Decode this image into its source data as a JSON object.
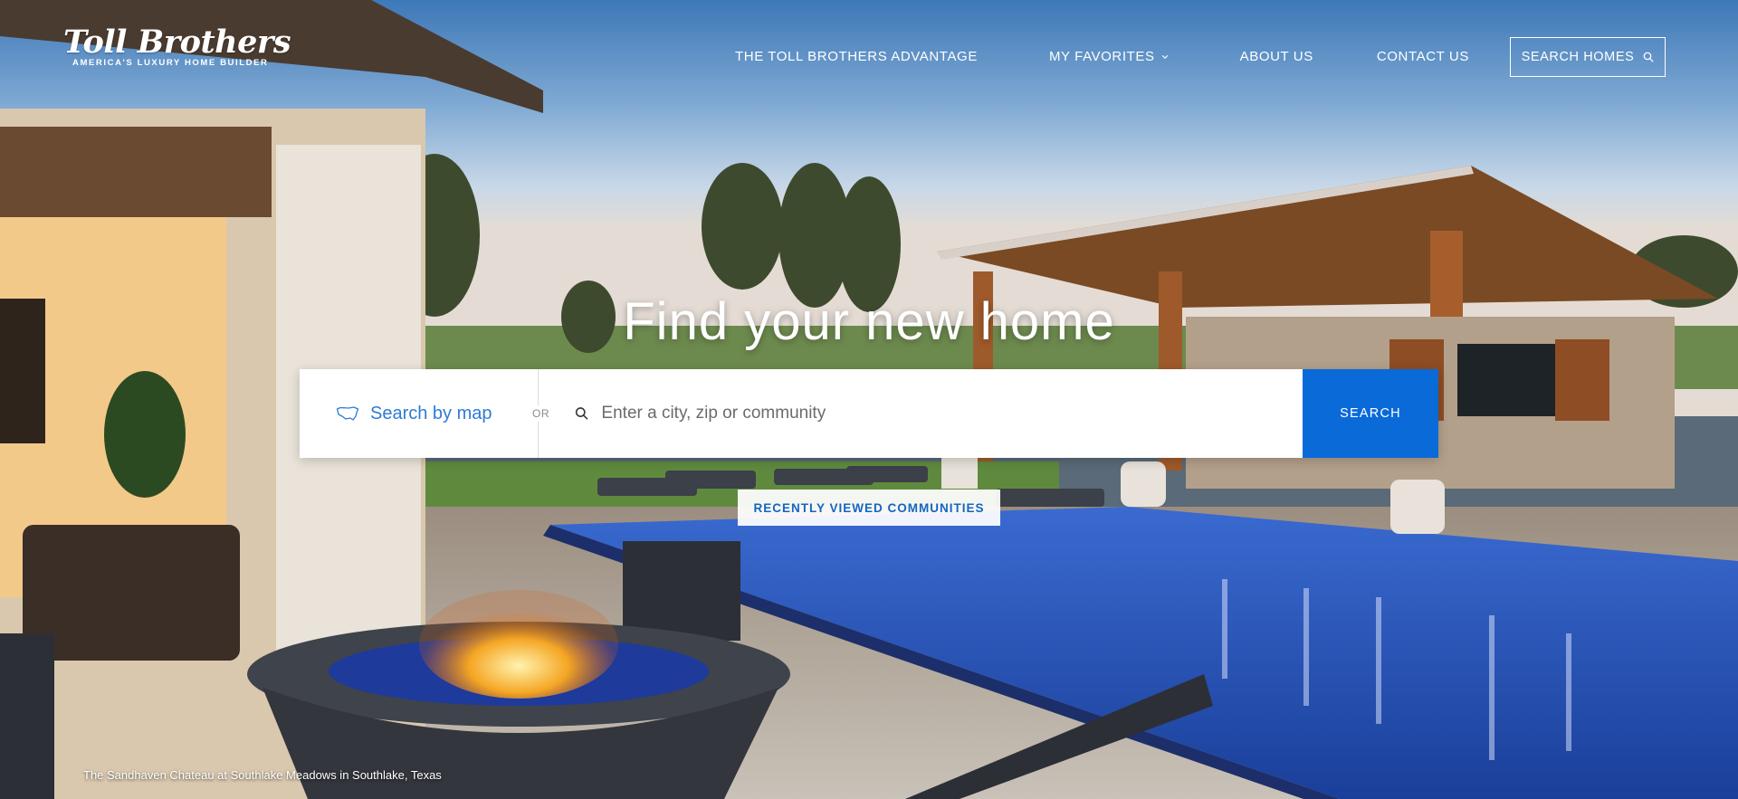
{
  "brand": {
    "wordmark": "Toll Brothers",
    "tagline": "AMERICA'S LUXURY HOME BUILDER"
  },
  "nav": {
    "items": [
      {
        "label": "THE TOLL BROTHERS ADVANTAGE"
      },
      {
        "label": "MY FAVORITES",
        "icon": "chevron-down-icon"
      },
      {
        "label": "ABOUT US"
      },
      {
        "label": "CONTACT US"
      }
    ],
    "search_homes_label": "SEARCH HOMES",
    "search_homes_icon": "search-icon"
  },
  "hero": {
    "headline": "Find your new home",
    "caption": "The Sandhaven Chateau at Southlake Meadows in Southlake, Texas"
  },
  "search": {
    "map_label": "Search by map",
    "map_icon": "us-map-icon",
    "or_label": "OR",
    "query_icon": "search-icon",
    "placeholder": "Enter a city, zip or community",
    "value": "",
    "button_label": "SEARCH"
  },
  "recently_viewed_label": "RECENTLY VIEWED COMMUNITIES",
  "colors": {
    "accent": "#0a6ad8",
    "link": "#2e7bd8"
  }
}
